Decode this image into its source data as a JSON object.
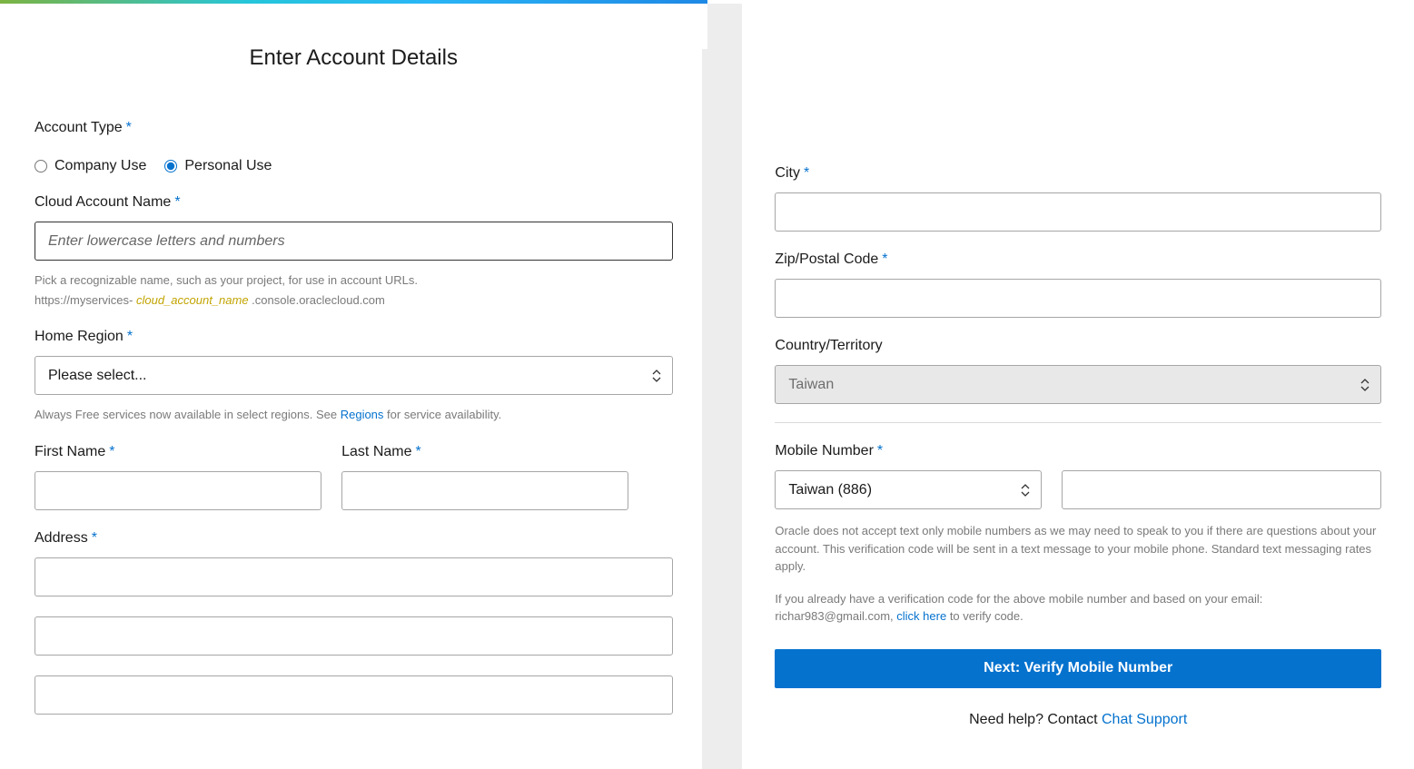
{
  "pageTitle": "Enter Account Details",
  "accountType": {
    "label": "Account Type",
    "options": {
      "company": "Company Use",
      "personal": "Personal Use"
    },
    "selected": "personal"
  },
  "cloudAccountName": {
    "label": "Cloud Account Name",
    "placeholder": "Enter lowercase letters and numbers",
    "helper1": "Pick a recognizable name, such as your project, for use in account URLs.",
    "helper2_prefix": "https://myservices- ",
    "helper2_accent": "cloud_account_name",
    "helper2_suffix": " .console.oraclecloud.com"
  },
  "homeRegion": {
    "label": "Home Region",
    "placeholder": "Please select...",
    "helper_prefix": "Always Free services now available in select regions. See ",
    "helper_link": "Regions",
    "helper_suffix": " for service availability."
  },
  "firstName": {
    "label": "First Name"
  },
  "lastName": {
    "label": "Last Name"
  },
  "address": {
    "label": "Address"
  },
  "city": {
    "label": "City"
  },
  "zip": {
    "label": "Zip/Postal Code"
  },
  "country": {
    "label": "Country/Territory",
    "value": "Taiwan"
  },
  "mobile": {
    "label": "Mobile Number",
    "countryCode": "Taiwan (886)",
    "fine1": "Oracle does not accept text only mobile numbers as we may need to speak to you if there are questions about your account. This verification code will be sent in a text message to your mobile phone. Standard text messaging rates apply.",
    "fine2_prefix": "If you already have a verification code for the above mobile number and based on your email: richar983@gmail.com, ",
    "fine2_link": "click here",
    "fine2_suffix": " to verify code."
  },
  "nextButton": "Next: Verify Mobile Number",
  "help": {
    "prefix": "Need help? Contact ",
    "link": "Chat Support"
  }
}
